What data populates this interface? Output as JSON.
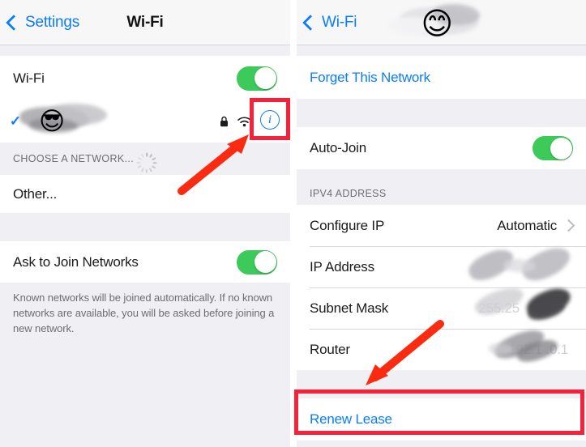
{
  "left_panel": {
    "navbar": {
      "back_label": "Settings",
      "title": "Wi-Fi",
      "back_icon": "chevron-left-icon"
    },
    "wifi_row": {
      "label": "Wi-Fi",
      "toggle_state": "on"
    },
    "connected_network": {
      "check_glyph": "✓",
      "name_redacted": true,
      "emoji": "😎",
      "icons": [
        "lock-icon",
        "wifi-signal-icon",
        "info-icon"
      ]
    },
    "choose_network_header": "CHOOSE A NETWORK...",
    "choose_network_spinner": "activity-spinner-icon",
    "other_row": {
      "label": "Other..."
    },
    "ask_to_join": {
      "label": "Ask to Join Networks",
      "toggle_state": "on"
    },
    "footnote": "Known networks will be joined automatically. If no known networks are available, you will be asked before joining a new network."
  },
  "right_panel": {
    "navbar": {
      "back_label": "Wi-Fi",
      "title_redacted": true,
      "title_emoji": "😊",
      "back_icon": "chevron-left-icon"
    },
    "forget_network": {
      "label": "Forget This Network"
    },
    "auto_join": {
      "label": "Auto-Join",
      "toggle_state": "on"
    },
    "ipv4_header": "IPV4 ADDRESS",
    "rows": [
      {
        "label": "Configure IP",
        "value": "Automatic",
        "chevron": true,
        "redacted": false
      },
      {
        "label": "IP Address",
        "value": "",
        "chevron": false,
        "redacted": true
      },
      {
        "label": "Subnet Mask",
        "value": "255.25",
        "chevron": false,
        "redacted": true
      },
      {
        "label": "Router",
        "value": "192.1   .0.1",
        "chevron": false,
        "redacted": true
      }
    ],
    "renew_lease": {
      "label": "Renew Lease"
    }
  },
  "annotations": {
    "highlight_color": "#f8213a",
    "arrow_color": "#fa2b11",
    "boxes": [
      {
        "target": "info-icon"
      },
      {
        "target": "renew-lease-row"
      }
    ],
    "arrows": [
      {
        "points_to": "info-icon"
      },
      {
        "points_to": "renew-lease-row"
      }
    ]
  }
}
